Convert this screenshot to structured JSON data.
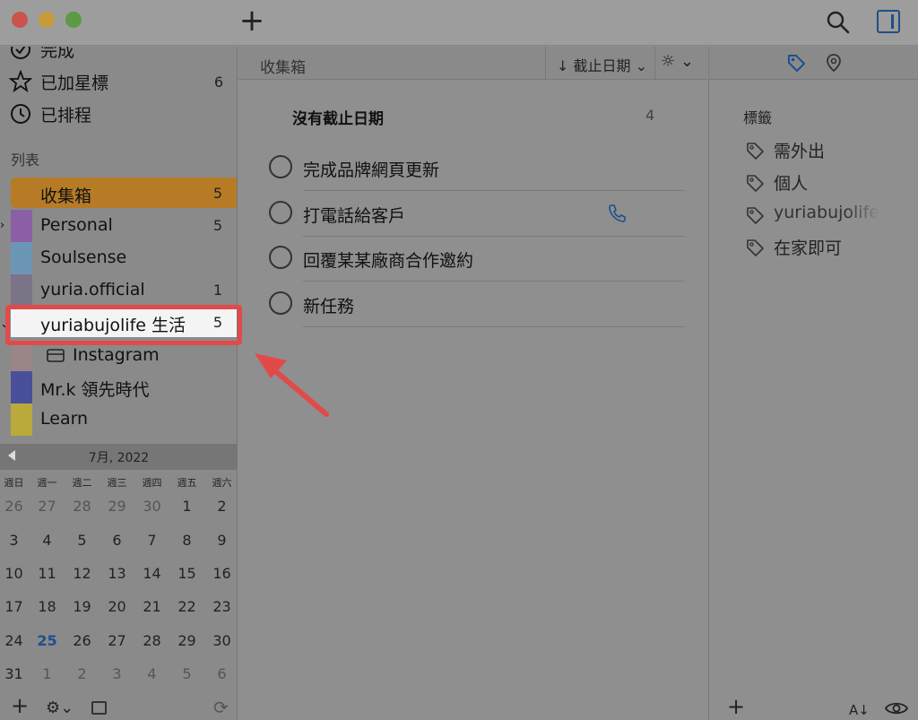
{
  "sidebar": {
    "top_items": [
      {
        "label": "完成",
        "icon": "check-circle-icon",
        "count": ""
      },
      {
        "label": "已加星標",
        "icon": "star-icon",
        "count": "6"
      },
      {
        "label": "已排程",
        "icon": "clock-icon",
        "count": ""
      }
    ],
    "section_title": "列表",
    "lists": [
      {
        "label": "收集箱",
        "count": "5",
        "color": "#b77b26"
      },
      {
        "label": "Personal",
        "count": "5",
        "color": "#8b5fa5"
      },
      {
        "label": "Soulsense",
        "count": "",
        "color": "#6c96b6"
      },
      {
        "label": "yuria.official",
        "count": "1",
        "color": "#7b7487"
      },
      {
        "label": "yuriabujolife 生活",
        "count": "5",
        "color": "#f0f0f0"
      },
      {
        "label": "Instagram",
        "count": "",
        "color": "#9a8686"
      },
      {
        "label": "Mr.k 領先時代",
        "count": "",
        "color": "#4a4f9b"
      },
      {
        "label": "Learn",
        "count": "",
        "color": "#b9aa3b"
      }
    ]
  },
  "calendar": {
    "month": "7月, 2022",
    "weekdays": [
      "週日",
      "週一",
      "週二",
      "週三",
      "週四",
      "週五",
      "週六"
    ],
    "weeks": [
      [
        "26",
        "27",
        "28",
        "29",
        "30",
        "1",
        "2"
      ],
      [
        "3",
        "4",
        "5",
        "6",
        "7",
        "8",
        "9"
      ],
      [
        "10",
        "11",
        "12",
        "13",
        "14",
        "15",
        "16"
      ],
      [
        "17",
        "18",
        "19",
        "20",
        "21",
        "22",
        "23"
      ],
      [
        "24",
        "25",
        "26",
        "27",
        "28",
        "29",
        "30"
      ],
      [
        "31",
        "1",
        "2",
        "3",
        "4",
        "5",
        "6"
      ]
    ],
    "today": "25"
  },
  "main": {
    "title": "收集箱",
    "sort_label": "截止日期",
    "group_title": "沒有截止日期",
    "group_count": "4",
    "tasks": [
      {
        "label": "完成品牌網頁更新",
        "has_phone": false
      },
      {
        "label": "打電話給客戶",
        "has_phone": true
      },
      {
        "label": "回覆某某廠商合作邀約",
        "has_phone": false
      },
      {
        "label": "新任務",
        "has_phone": false
      }
    ]
  },
  "right": {
    "title": "標籤",
    "tags": [
      "需外出",
      "個人",
      "yuriabujolife",
      "在家即可"
    ],
    "sort_label": "A↓"
  },
  "colors": {
    "accent": "#1d4f8f",
    "highlight_red": "#e24a4a",
    "inbox_orange": "#b77b26"
  }
}
